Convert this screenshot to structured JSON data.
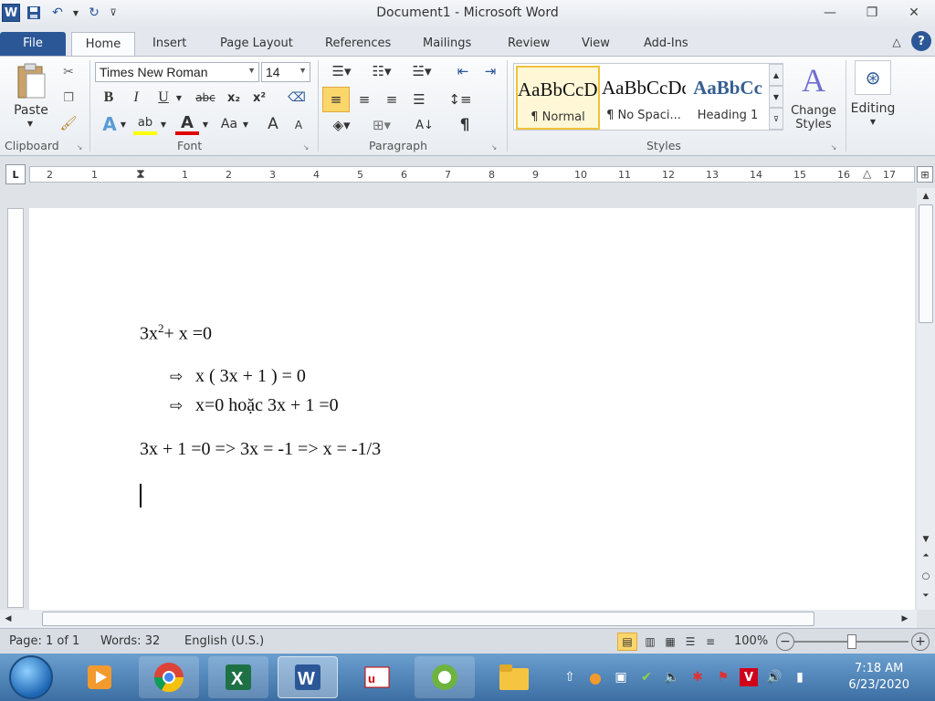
{
  "window": {
    "title": "Document1 - Microsoft Word",
    "app_icon_letter": "W"
  },
  "tabs": [
    "File",
    "Home",
    "Insert",
    "Page Layout",
    "References",
    "Mailings",
    "Review",
    "View",
    "Add-Ins"
  ],
  "ribbon": {
    "clipboard": {
      "paste_label": "Paste",
      "group_label": "Clipboard"
    },
    "font": {
      "group_label": "Font",
      "font_name": "Times New Roman",
      "font_size": "14",
      "bold": "B",
      "italic": "I",
      "underline": "U",
      "strike": "abc",
      "subscript": "x₂",
      "superscript": "x²",
      "font_color": "A",
      "change_case": "Aa",
      "grow": "A",
      "shrink": "A"
    },
    "paragraph": {
      "group_label": "Paragraph",
      "pilcrow": "¶"
    },
    "styles": {
      "group_label": "Styles",
      "items": [
        {
          "sample": "AaBbCcDd",
          "name": "¶ Normal"
        },
        {
          "sample": "AaBbCcDd",
          "name": "¶ No Spaci..."
        },
        {
          "sample": "AaBbCc",
          "name": "Heading 1"
        }
      ],
      "change_styles": "Change Styles"
    },
    "editing": {
      "label": "Editing"
    }
  },
  "ruler": {
    "corner": "L",
    "marks": [
      "2",
      "1",
      "1",
      "2",
      "3",
      "4",
      "5",
      "6",
      "7",
      "8",
      "9",
      "10",
      "11",
      "12",
      "13",
      "14",
      "15",
      "16",
      "17"
    ]
  },
  "document": {
    "line1_base": "3x",
    "line1_sup": "2",
    "line1_rest": "+ x =0",
    "arrow": "⇨",
    "line2": "x ( 3x + 1 ) = 0",
    "line3": "x=0 hoặc 3x + 1 =0",
    "line4": "3x + 1 =0 => 3x = -1 => x = -1/3"
  },
  "status": {
    "page": "Page: 1 of 1",
    "words": "Words: 32",
    "language": "English (U.S.)",
    "zoom": "100%"
  },
  "taskbar": {
    "clock_time": "7:18 AM",
    "clock_date": "6/23/2020"
  },
  "colors": {
    "accent": "#2b5797",
    "style_selected": "#f0c23c",
    "heading_blue": "#365f91"
  }
}
